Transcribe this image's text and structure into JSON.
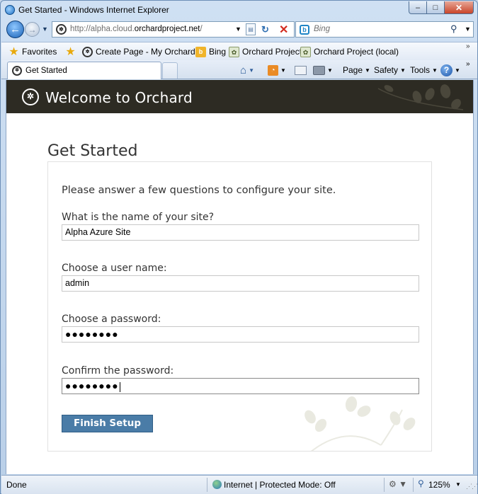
{
  "window": {
    "title": "Get Started - Windows Internet Explorer",
    "min_glyph": "–",
    "max_glyph": "□",
    "close_glyph": "✕"
  },
  "address": {
    "url_prefix": "http://alpha.cloud.",
    "url_domain": "orchardproject.net",
    "url_suffix": "/",
    "back_glyph": "←",
    "forward_glyph": "→"
  },
  "search": {
    "placeholder": "Bing"
  },
  "favorites_bar": {
    "favorites_label": "Favorites",
    "items": [
      {
        "label": "Create Page - My Orchard...",
        "icon": "orchard-icon"
      },
      {
        "label": "Bing",
        "icon": "bing-icon"
      },
      {
        "label": "Orchard Project",
        "icon": "orchard-leaf-icon"
      },
      {
        "label": "Orchard Project  (local)",
        "icon": "orchard-leaf-icon"
      }
    ]
  },
  "tabs": [
    {
      "label": "Get Started",
      "active": true
    }
  ],
  "command_bar": {
    "page_label": "Page",
    "safety_label": "Safety",
    "tools_label": "Tools"
  },
  "page": {
    "header_title": "Welcome to Orchard",
    "heading": "Get Started",
    "intro": "Please answer a few questions to configure your site.",
    "fields": {
      "site_name_label": "What is the name of your site?",
      "site_name_value": "Alpha Azure Site",
      "username_label": "Choose a user name:",
      "username_value": "admin",
      "password_label": "Choose a password:",
      "password_mask": "●●●●●●●●",
      "confirm_label": "Confirm the password:",
      "confirm_mask": "●●●●●●●●"
    },
    "finish_button": "Finish Setup"
  },
  "status_bar": {
    "status": "Done",
    "zone": "Internet | Protected Mode: Off",
    "zoom": "125%"
  },
  "colors": {
    "header_bg": "#2d2b23",
    "button_bg": "#4a7ca7"
  }
}
